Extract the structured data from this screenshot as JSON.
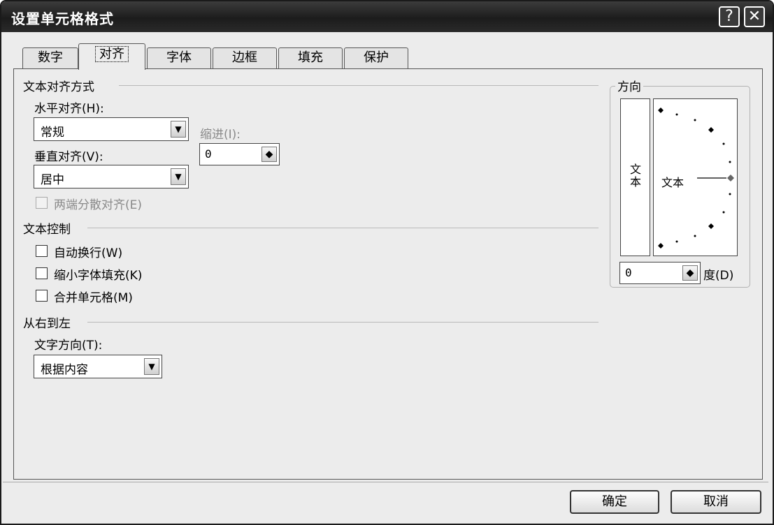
{
  "title": "设置单元格格式",
  "titlebar": {
    "help": "?",
    "close": "✕"
  },
  "tabs": [
    {
      "label": "数字"
    },
    {
      "label": "对齐"
    },
    {
      "label": "字体"
    },
    {
      "label": "边框"
    },
    {
      "label": "填充"
    },
    {
      "label": "保护"
    }
  ],
  "alignment": {
    "section": "文本对齐方式",
    "horizontal_label": "水平对齐(H):",
    "horizontal_value": "常规",
    "indent_label": "缩进(I):",
    "indent_value": "0",
    "vertical_label": "垂直对齐(V):",
    "vertical_value": "居中",
    "justify_distributed": "两端分散对齐(E)"
  },
  "text_control": {
    "section": "文本控制",
    "wrap_text": "自动换行(W)",
    "shrink_to_fit": "缩小字体填充(K)",
    "merge_cells": "合并单元格(M)"
  },
  "rtl": {
    "section": "从右到左",
    "direction_label": "文字方向(T):",
    "direction_value": "根据内容"
  },
  "orientation": {
    "section": "方向",
    "vertical_text": "文本",
    "dial_text": "文本",
    "degrees_value": "0",
    "degrees_label": "度(D)"
  },
  "buttons": {
    "ok": "确定",
    "cancel": "取消"
  },
  "icons": {
    "dropdown": "▼",
    "spinner": "◆"
  }
}
